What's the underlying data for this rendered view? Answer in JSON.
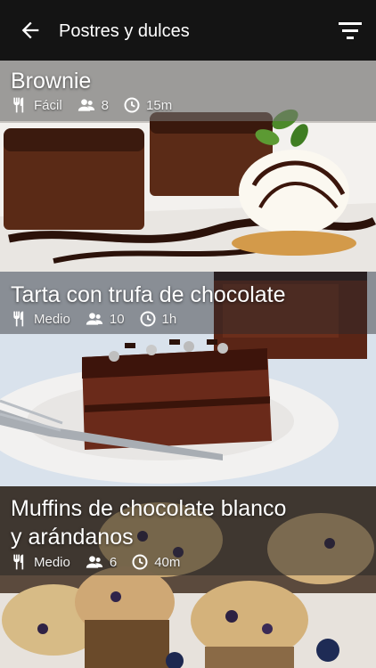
{
  "toolbar": {
    "title": "Postres y dulces",
    "back_icon": "arrow-left-icon",
    "filter_icon": "filter-icon"
  },
  "recipes": [
    {
      "title": "Brownie",
      "difficulty": "Fácil",
      "servings": "8",
      "time": "15m"
    },
    {
      "title": "Tarta con trufa de chocolate",
      "difficulty": "Medio",
      "servings": "10",
      "time": "1h"
    },
    {
      "title_line1": "Muffins de chocolate blanco",
      "title_line2": "y arándanos",
      "difficulty": "Medio",
      "servings": "6",
      "time": "40m"
    }
  ],
  "icons": [
    "cutlery-icon",
    "people-icon",
    "clock-icon"
  ]
}
